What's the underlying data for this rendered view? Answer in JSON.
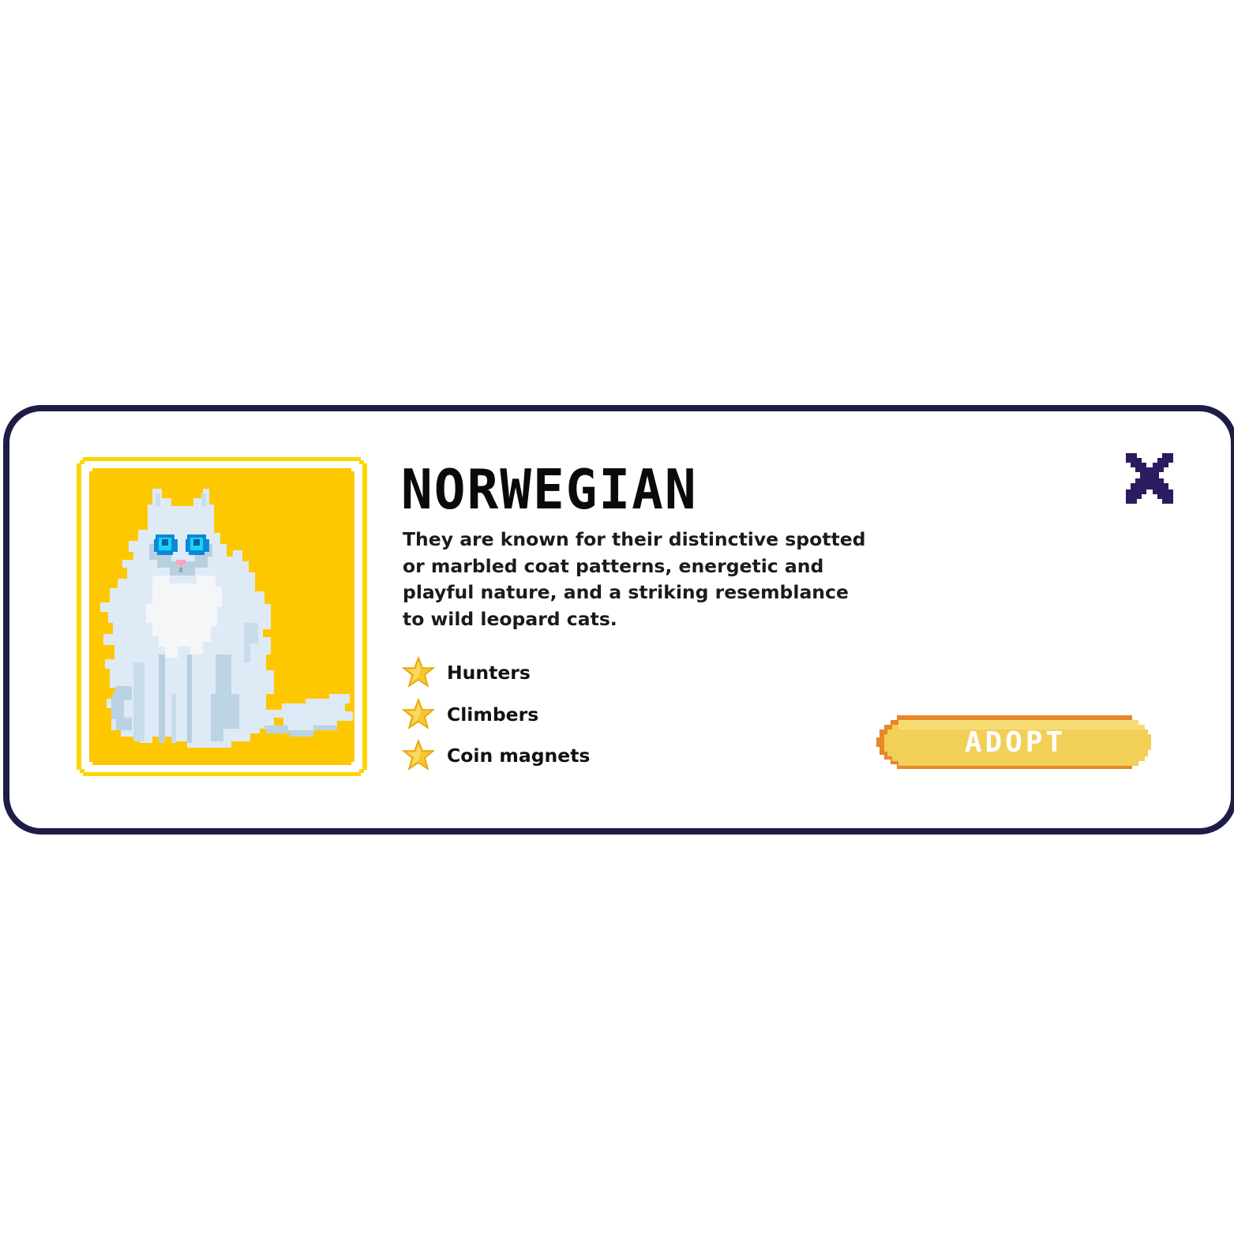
{
  "breed": {
    "name": "NORWEGIAN",
    "description": "They are known for their distinctive spotted or marbled coat patterns, energetic and playful nature, and a striking resemblance to wild leopard cats.",
    "traits": [
      {
        "label": "Hunters",
        "icon": "star-icon"
      },
      {
        "label": "Climbers",
        "icon": "star-icon"
      },
      {
        "label": "Coin magnets",
        "icon": "star-icon"
      }
    ]
  },
  "actions": {
    "adopt_label": "ADOPT",
    "close_icon": "close-icon"
  },
  "colors": {
    "card_border": "#1e1d47",
    "portrait_bg": "#fec800",
    "portrait_frame": "#fdd400",
    "close": "#2d1b5f",
    "adopt_fill": "#f2cf57",
    "adopt_border": "#e8862a"
  }
}
